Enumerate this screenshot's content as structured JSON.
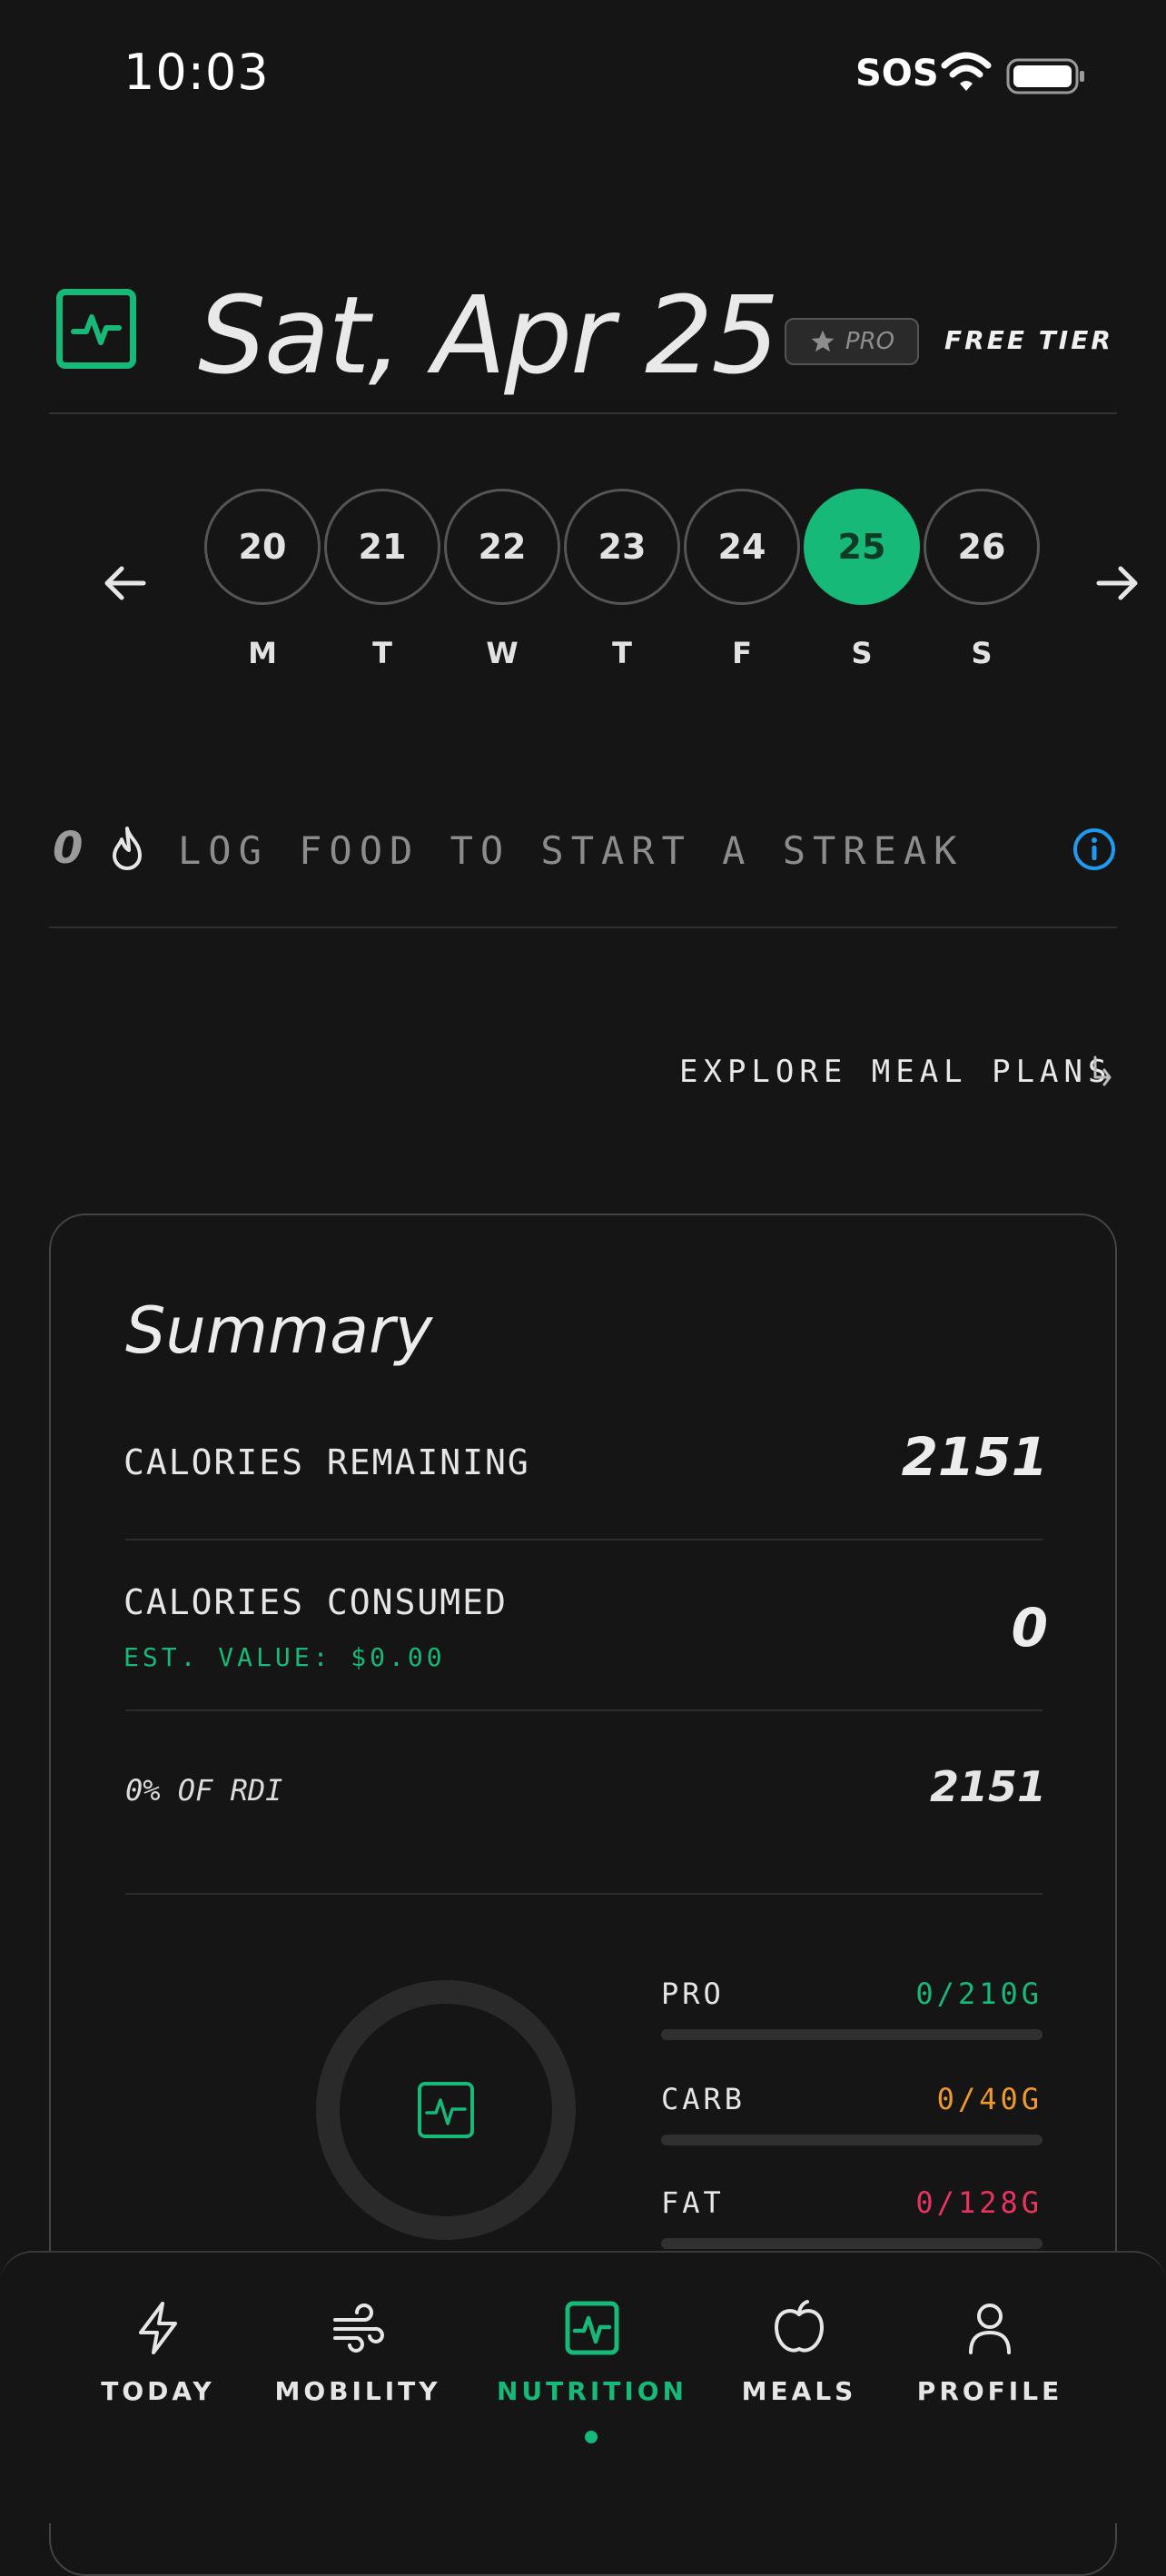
{
  "status_bar": {
    "time": "10:03",
    "sos": "SOS"
  },
  "header": {
    "date": "Sat, Apr 25",
    "pro_label": "PRO",
    "tier_label": "FREE TIER"
  },
  "week": {
    "days": [
      {
        "num": "20",
        "letter": "M"
      },
      {
        "num": "21",
        "letter": "T"
      },
      {
        "num": "22",
        "letter": "W"
      },
      {
        "num": "23",
        "letter": "T"
      },
      {
        "num": "24",
        "letter": "F"
      },
      {
        "num": "25",
        "letter": "S"
      },
      {
        "num": "26",
        "letter": "S"
      }
    ],
    "selected_day": "25"
  },
  "streak": {
    "count": "0",
    "text": "LOG FOOD TO START A STREAK"
  },
  "explore": {
    "label": "EXPLORE MEAL PLANS"
  },
  "summary": {
    "title": "Summary",
    "calories_remaining_label": "CALORIES REMAINING",
    "calories_remaining_value": "2151",
    "calories_consumed_label": "CALORIES CONSUMED",
    "calories_consumed_value": "0",
    "est_value": "EST. VALUE: $0.00",
    "rdi_label": "0% OF RDI",
    "rdi_value": "2151",
    "ring_progress": 0,
    "macros": [
      {
        "label": "PRO",
        "value": "0/210G",
        "color": "#17b978",
        "progress": 0
      },
      {
        "label": "CARB",
        "value": "0/40G",
        "color": "#f0992b",
        "progress": 0
      },
      {
        "label": "FAT",
        "value": "0/128G",
        "color": "#e8335e",
        "progress": 0
      }
    ]
  },
  "tabs": [
    {
      "label": "TODAY",
      "icon": "lightning-icon"
    },
    {
      "label": "MOBILITY",
      "icon": "wind-icon"
    },
    {
      "label": "NUTRITION",
      "icon": "pulse-icon"
    },
    {
      "label": "MEALS",
      "icon": "apple-icon"
    },
    {
      "label": "PROFILE",
      "icon": "person-icon"
    }
  ],
  "active_tab": "NUTRITION",
  "colors": {
    "accent": "#17b978",
    "background": "#151515",
    "info": "#1e9bf0"
  }
}
